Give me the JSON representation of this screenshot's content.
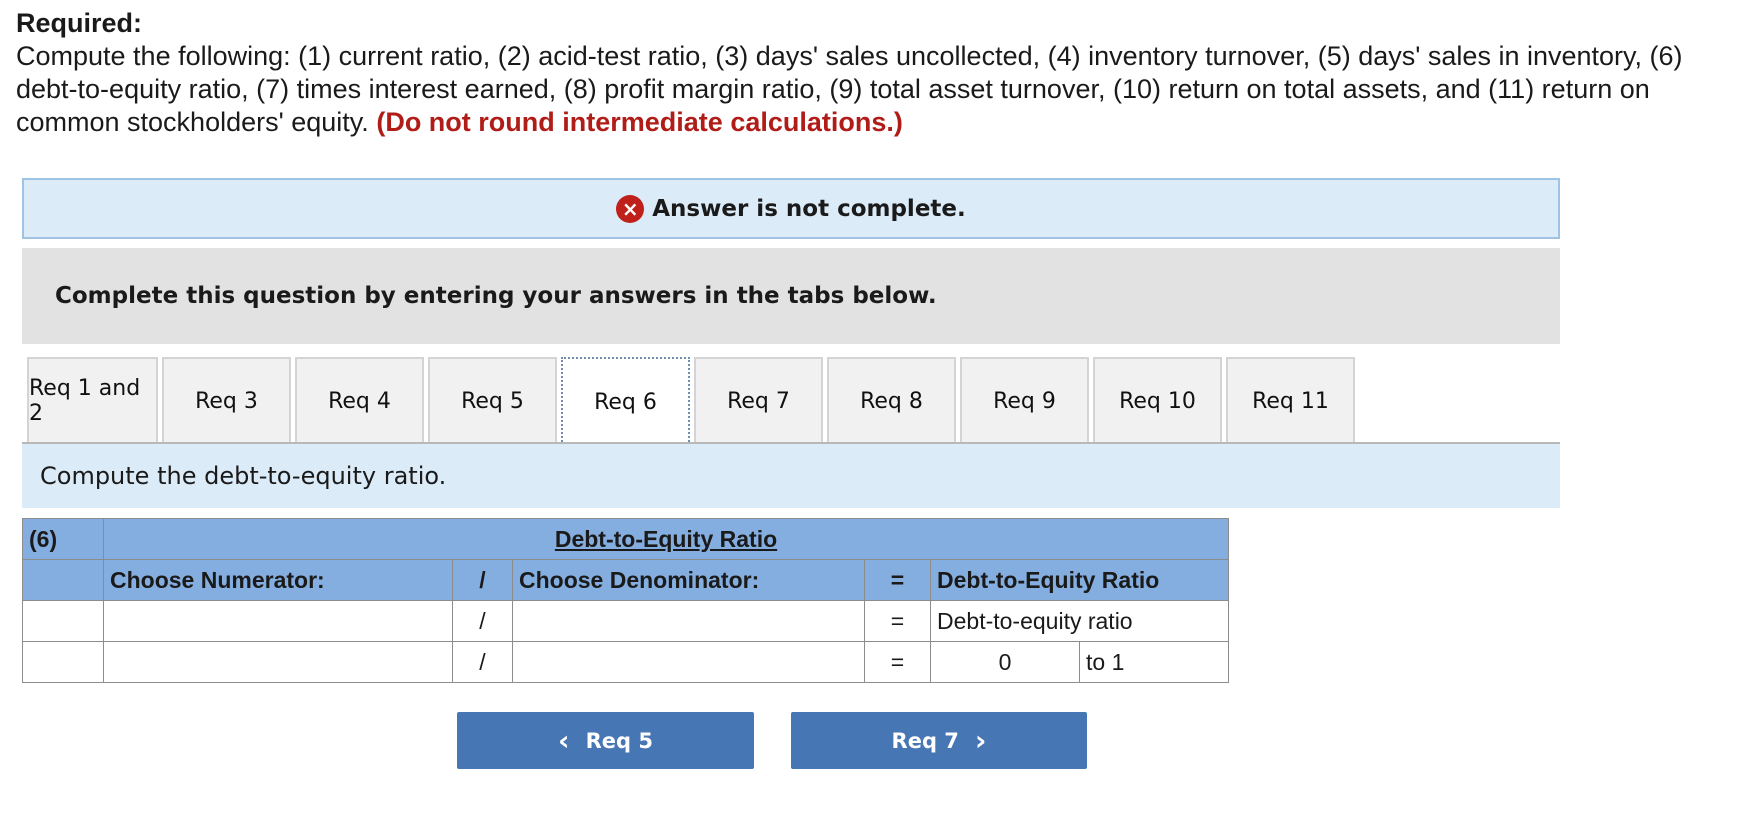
{
  "header": {
    "required_label": "Required:",
    "instructions": "Compute the following: (1) current ratio, (2) acid-test ratio, (3) days' sales uncollected, (4) inventory turnover, (5) days' sales in inventory, (6) debt-to-equity ratio, (7) times interest earned, (8) profit margin ratio, (9) total asset turnover, (10) return on total assets, and (11) return on common stockholders' equity.",
    "warning": "(Do not round intermediate calculations.)"
  },
  "status": {
    "icon": "x-circle-icon",
    "icon_glyph": "×",
    "message": "Answer is not complete.",
    "color": "#c0201a"
  },
  "instruction_bar": "Complete this question by entering your answers in the tabs below.",
  "tabs": [
    {
      "label": "Req 1 and 2",
      "active": false
    },
    {
      "label": "Req 3",
      "active": false
    },
    {
      "label": "Req 4",
      "active": false
    },
    {
      "label": "Req 5",
      "active": false
    },
    {
      "label": "Req 6",
      "active": true
    },
    {
      "label": "Req 7",
      "active": false
    },
    {
      "label": "Req 8",
      "active": false
    },
    {
      "label": "Req 9",
      "active": false
    },
    {
      "label": "Req 10",
      "active": false
    },
    {
      "label": "Req 11",
      "active": false
    }
  ],
  "prompt": "Compute the debt-to-equity ratio.",
  "table": {
    "number": "(6)",
    "title": "Debt-to-Equity Ratio",
    "numerator_header": "Choose Numerator:",
    "divide_symbol": "/",
    "denominator_header": "Choose Denominator:",
    "equals_symbol": "=",
    "result_header": "Debt-to-Equity Ratio",
    "row1": {
      "numerator": "",
      "denominator": "",
      "result_label": "Debt-to-equity ratio"
    },
    "row2": {
      "numerator": "",
      "denominator": "",
      "result_value": "0",
      "suffix": "to 1"
    }
  },
  "nav": {
    "prev_label": "Req 5",
    "next_label": "Req 7",
    "prev_glyph": "‹",
    "next_glyph": "›"
  },
  "colors": {
    "banner_bg": "#dcebf8",
    "table_header_bg": "#85aee0",
    "button_bg": "#4676b4",
    "warning_red": "#b01c17"
  }
}
